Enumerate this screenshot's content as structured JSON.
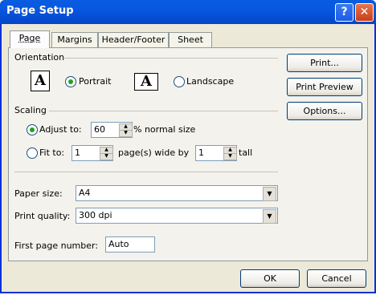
{
  "window": {
    "title": "Page Setup",
    "help_glyph": "?",
    "close_glyph": "✕"
  },
  "tabs": [
    "Page",
    "Margins",
    "Header/Footer",
    "Sheet"
  ],
  "orientation": {
    "label": "Orientation",
    "portrait_label": "Portrait",
    "landscape_label": "Landscape",
    "selected": "Portrait",
    "icon_glyph": "A"
  },
  "scaling": {
    "label": "Scaling",
    "adjust_label": "Adjust to:",
    "adjust_value": "60",
    "adjust_suffix": "% normal size",
    "fit_label": "Fit to:",
    "fit_wide_value": "1",
    "fit_wide_suffix": "page(s) wide by",
    "fit_tall_value": "1",
    "fit_tall_suffix": "tall",
    "selected": "Adjust to:"
  },
  "paper": {
    "paper_size_label": "Paper size:",
    "paper_size_value": "A4",
    "print_quality_label": "Print quality:",
    "print_quality_value": "300 dpi",
    "first_page_label": "First page number:",
    "first_page_value": "Auto"
  },
  "side_buttons": {
    "print": "Print...",
    "print_preview": "Print Preview",
    "options": "Options..."
  },
  "footer_buttons": {
    "ok": "OK",
    "cancel": "Cancel"
  }
}
